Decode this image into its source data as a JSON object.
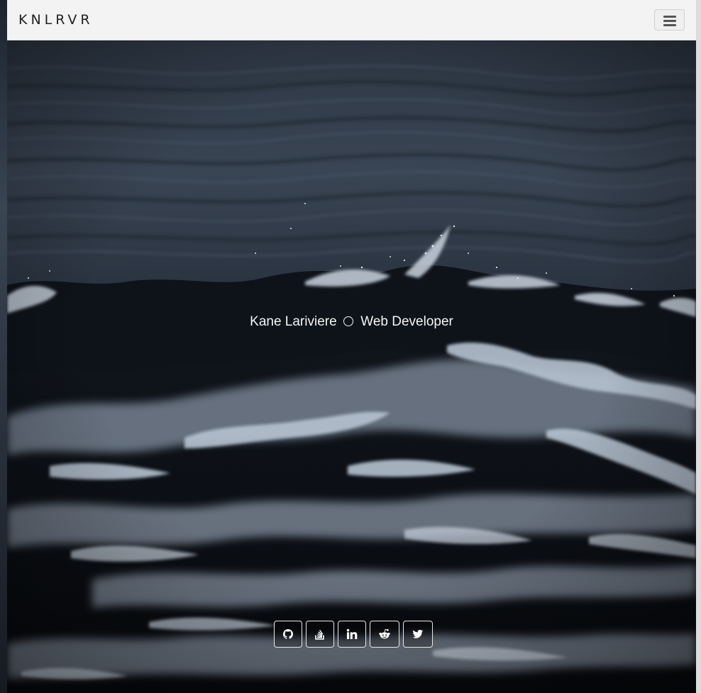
{
  "navbar": {
    "brand": "KNLRVR",
    "toggler_icon": "hamburger-icon"
  },
  "hero": {
    "name": "Kane Lariviere",
    "role": "Web Developer",
    "separator_icon": "circle-icon"
  },
  "social": [
    {
      "icon": "github-icon",
      "label": "GitHub"
    },
    {
      "icon": "stack-overflow-icon",
      "label": "Stack Overflow"
    },
    {
      "icon": "linkedin-icon",
      "label": "LinkedIn"
    },
    {
      "icon": "reddit-icon",
      "label": "Reddit"
    },
    {
      "icon": "twitter-icon",
      "label": "Twitter"
    }
  ],
  "colors": {
    "navbar_bg": "#f3f3f3",
    "hero_text": "#f4f4f4",
    "sea_dark": "#0b0e13",
    "sea_mid": "#3b4656"
  }
}
